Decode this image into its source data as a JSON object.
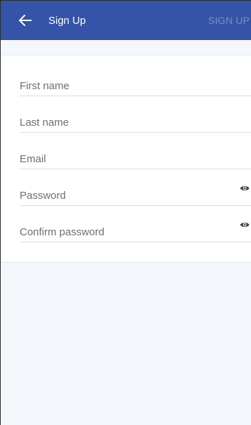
{
  "appbar": {
    "title": "Sign Up",
    "action_label": "SIGN UP",
    "back_icon": "arrow-left-icon",
    "background_color": "#3554a7"
  },
  "form": {
    "fields": [
      {
        "placeholder": "First name"
      },
      {
        "placeholder": "Last name"
      },
      {
        "placeholder": "Email"
      },
      {
        "placeholder": "Password",
        "icon": "eye-icon"
      },
      {
        "placeholder": "Confirm password",
        "icon": "eye-icon"
      }
    ]
  }
}
